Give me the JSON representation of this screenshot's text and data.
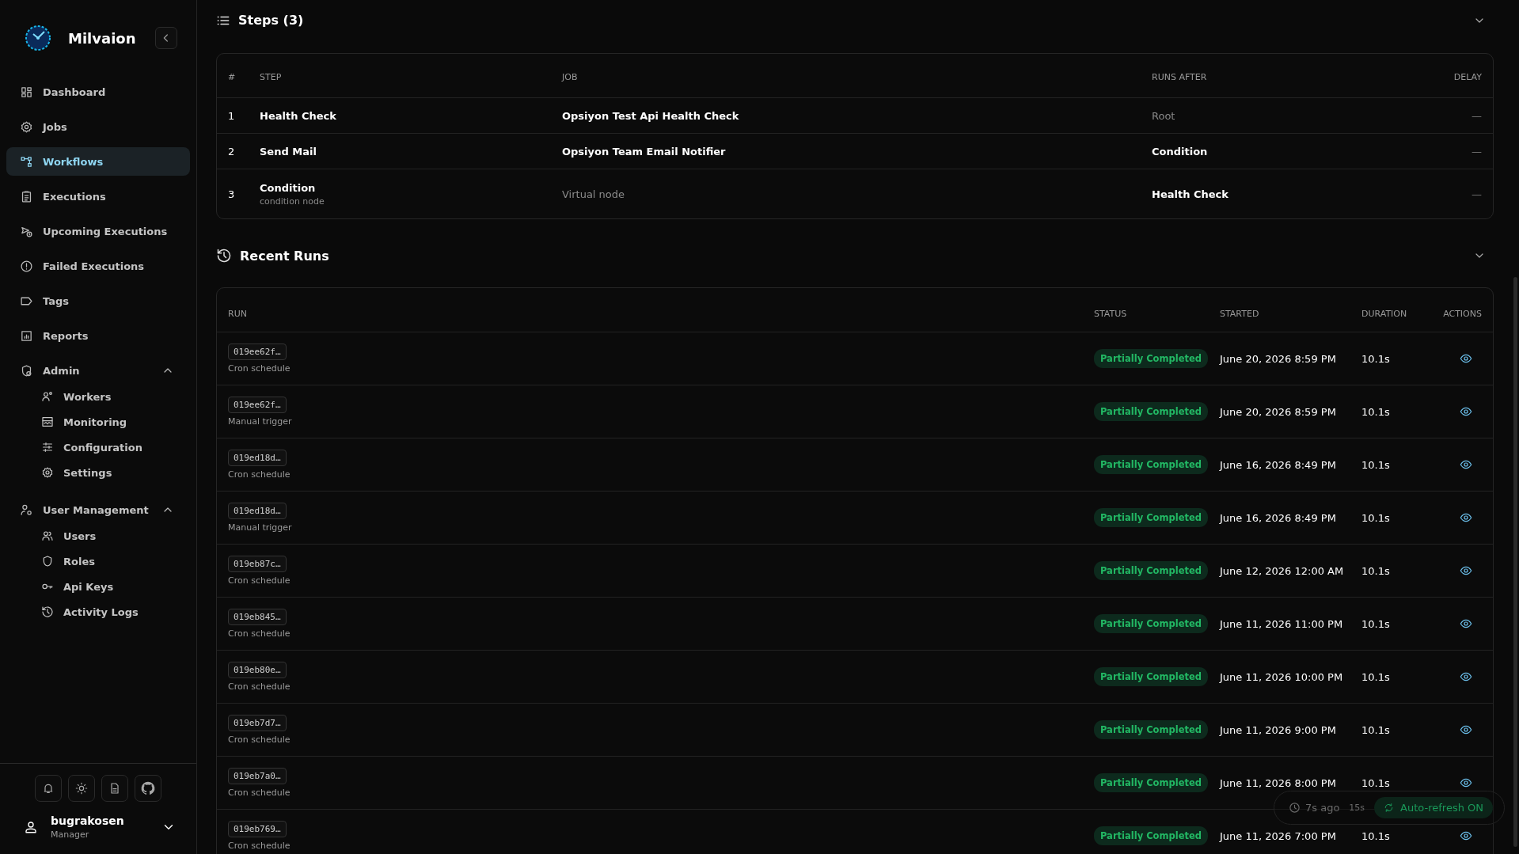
{
  "brand": {
    "name": "Milvaion"
  },
  "nav": [
    {
      "label": "Dashboard",
      "selected": false
    },
    {
      "label": "Jobs",
      "selected": false
    },
    {
      "label": "Workflows",
      "selected": true
    },
    {
      "label": "Executions",
      "selected": false
    },
    {
      "label": "Upcoming Executions",
      "selected": false
    },
    {
      "label": "Failed Executions",
      "selected": false
    },
    {
      "label": "Tags",
      "selected": false
    },
    {
      "label": "Reports",
      "selected": false
    },
    {
      "label": "Admin",
      "selected": false,
      "expanded": true,
      "children": [
        {
          "label": "Workers",
          "selected": false
        },
        {
          "label": "Monitoring",
          "selected": false
        },
        {
          "label": "Configuration",
          "selected": false
        },
        {
          "label": "Settings",
          "selected": false
        }
      ]
    },
    {
      "label": "User Management",
      "selected": false,
      "expanded": true,
      "children": [
        {
          "label": "Users",
          "selected": false
        },
        {
          "label": "Roles",
          "selected": false
        },
        {
          "label": "Api Keys",
          "selected": false
        },
        {
          "label": "Activity Logs",
          "selected": false
        }
      ]
    }
  ],
  "user": {
    "name": "bugrakosen",
    "role": "Manager"
  },
  "steps": {
    "title": "Steps (3)",
    "columns": [
      "#",
      "STEP",
      "JOB",
      "RUNS AFTER",
      "DELAY"
    ],
    "rows": [
      {
        "index": "1",
        "step": "Health Check",
        "job": "Opsiyon Test Api Health Check",
        "job_virtual": false,
        "runs_after": "Root",
        "runs_after_root": true,
        "delay": "—"
      },
      {
        "index": "2",
        "step": "Send Mail",
        "job": "Opsiyon Team Email Notifier",
        "job_virtual": false,
        "runs_after": "Condition",
        "runs_after_root": false,
        "delay": "—"
      },
      {
        "index": "3",
        "step": "Condition",
        "note": "condition node",
        "job": "Virtual node",
        "job_virtual": true,
        "runs_after": "Health Check",
        "runs_after_root": false,
        "delay": "—"
      }
    ]
  },
  "runs": {
    "title": "Recent Runs",
    "columns": [
      "RUN",
      "STATUS",
      "STARTED",
      "DURATION",
      "ACTIONS"
    ],
    "rows": [
      {
        "id": "019ee62f…",
        "trigger": "Cron schedule",
        "status": "Partially Completed",
        "started": "June 20, 2026 8:59 PM",
        "duration": "10.1s"
      },
      {
        "id": "019ee62f…",
        "trigger": "Manual trigger",
        "status": "Partially Completed",
        "started": "June 20, 2026 8:59 PM",
        "duration": "10.1s"
      },
      {
        "id": "019ed18d…",
        "trigger": "Cron schedule",
        "status": "Partially Completed",
        "started": "June 16, 2026 8:49 PM",
        "duration": "10.1s"
      },
      {
        "id": "019ed18d…",
        "trigger": "Manual trigger",
        "status": "Partially Completed",
        "started": "June 16, 2026 8:49 PM",
        "duration": "10.1s"
      },
      {
        "id": "019eb87c…",
        "trigger": "Cron schedule",
        "status": "Partially Completed",
        "started": "June 12, 2026 12:00 AM",
        "duration": "10.1s"
      },
      {
        "id": "019eb845…",
        "trigger": "Cron schedule",
        "status": "Partially Completed",
        "started": "June 11, 2026 11:00 PM",
        "duration": "10.1s"
      },
      {
        "id": "019eb80e…",
        "trigger": "Cron schedule",
        "status": "Partially Completed",
        "started": "June 11, 2026 10:00 PM",
        "duration": "10.1s"
      },
      {
        "id": "019eb7d7…",
        "trigger": "Cron schedule",
        "status": "Partially Completed",
        "started": "June 11, 2026 9:00 PM",
        "duration": "10.1s"
      },
      {
        "id": "019eb7a0…",
        "trigger": "Cron schedule",
        "status": "Partially Completed",
        "started": "June 11, 2026 8:00 PM",
        "duration": "10.1s"
      },
      {
        "id": "019eb769…",
        "trigger": "Cron schedule",
        "status": "Partially Completed",
        "started": "June 11, 2026 7:00 PM",
        "duration": "10.1s"
      }
    ]
  },
  "refresh": {
    "last": "7s ago",
    "interval": "15s",
    "label": "Auto-refresh ON",
    "on": true
  }
}
